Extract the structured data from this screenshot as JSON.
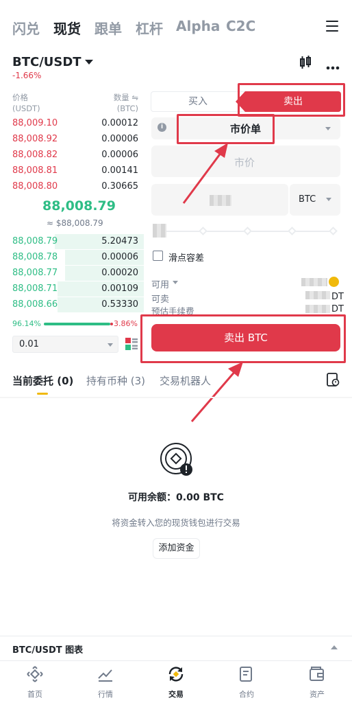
{
  "topnav": {
    "items": [
      "闪兑",
      "现货",
      "跟单",
      "杠杆",
      "Alpha",
      "C2C"
    ],
    "active": "现货"
  },
  "pair": {
    "symbol": "BTC/USDT",
    "change": "-1.66%"
  },
  "orderbook": {
    "price_header": "价格",
    "price_unit": "(USDT)",
    "qty_header": "数量 ⇋",
    "qty_unit": "(BTC)",
    "asks": [
      {
        "price": "88,009.10",
        "qty": "0.00012"
      },
      {
        "price": "88,008.92",
        "qty": "0.00006"
      },
      {
        "price": "88,008.82",
        "qty": "0.00006"
      },
      {
        "price": "88,008.81",
        "qty": "0.00141"
      },
      {
        "price": "88,008.80",
        "qty": "0.30665"
      }
    ],
    "mid_price": "88,008.79",
    "mid_fiat": "≈ $88,008.79",
    "bids": [
      {
        "price": "88,008.79",
        "qty": "5.20473",
        "depth": 0.62
      },
      {
        "price": "88,008.78",
        "qty": "0.00006",
        "depth": 0.55
      },
      {
        "price": "88,008.77",
        "qty": "0.00020",
        "depth": 0.55
      },
      {
        "price": "88,008.71",
        "qty": "0.00109",
        "depth": 0.6
      },
      {
        "price": "88,008.66",
        "qty": "0.53330",
        "depth": 0.6
      }
    ],
    "buy_ratio": "96.14%",
    "sell_ratio": "3.86%",
    "buy_ratio_value": 96.14,
    "precision": "0.01"
  },
  "form": {
    "buy_tab": "买入",
    "sell_tab": "卖出",
    "active_side": "卖出",
    "order_type": "市价单",
    "price_placeholder": "市价",
    "amount_unit": "BTC",
    "slippage_label": "滑点容差",
    "available_label": "可用",
    "sellable_label": "可卖",
    "fee_label": "预估手续费",
    "unit_partial": "DT",
    "sell_button": "卖出 BTC"
  },
  "lower_tabs": {
    "open_orders": "当前委托 (0)",
    "holdings": "持有币种 (3)",
    "bots": "交易机器人"
  },
  "empty": {
    "title": "可用余额：0.00 BTC",
    "subtitle": "将资金转入您的现货钱包进行交易",
    "button": "添加资金"
  },
  "chart_bar": {
    "label": "BTC/USDT 图表"
  },
  "bottom_nav": [
    "首页",
    "行情",
    "交易",
    "合约",
    "资产"
  ],
  "bottom_nav_active": "交易",
  "colors": {
    "up": "#2ebd85",
    "down": "#e0394a",
    "accent": "#f0b90b"
  }
}
